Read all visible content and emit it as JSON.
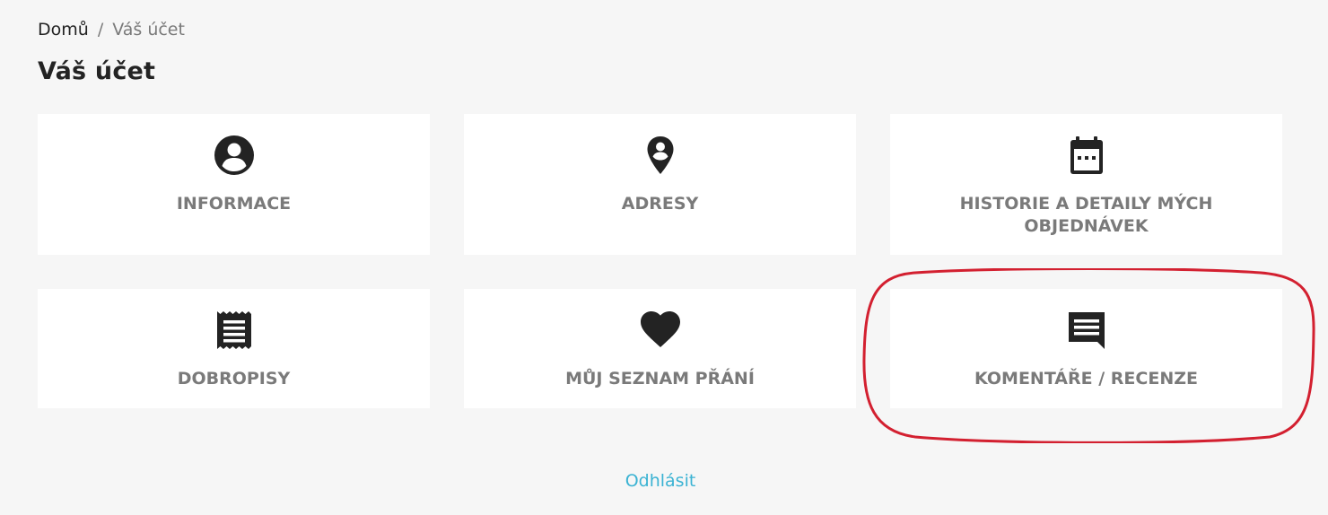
{
  "breadcrumb": {
    "home": "Domů",
    "separator": "/",
    "current": "Váš účet"
  },
  "page_title": "Váš účet",
  "cards": [
    {
      "label": "INFORMACE",
      "icon": "account-circle-icon"
    },
    {
      "label": "ADRESY",
      "icon": "location-pin-icon"
    },
    {
      "label": "HISTORIE A DETAILY MÝCH OBJEDNÁVEK",
      "icon": "calendar-icon"
    },
    {
      "label": "DOBROPISY",
      "icon": "receipt-icon"
    },
    {
      "label": "MŮJ SEZNAM PŘÁNÍ",
      "icon": "heart-icon"
    },
    {
      "label": "KOMENTÁŘE / RECENZE",
      "icon": "comment-icon"
    }
  ],
  "logout": "Odhlásit",
  "colors": {
    "background": "#f6f6f6",
    "card": "#ffffff",
    "text": "#232323",
    "muted": "#7a7a7a",
    "link": "#3bb3d3",
    "highlight": "#d32030"
  }
}
